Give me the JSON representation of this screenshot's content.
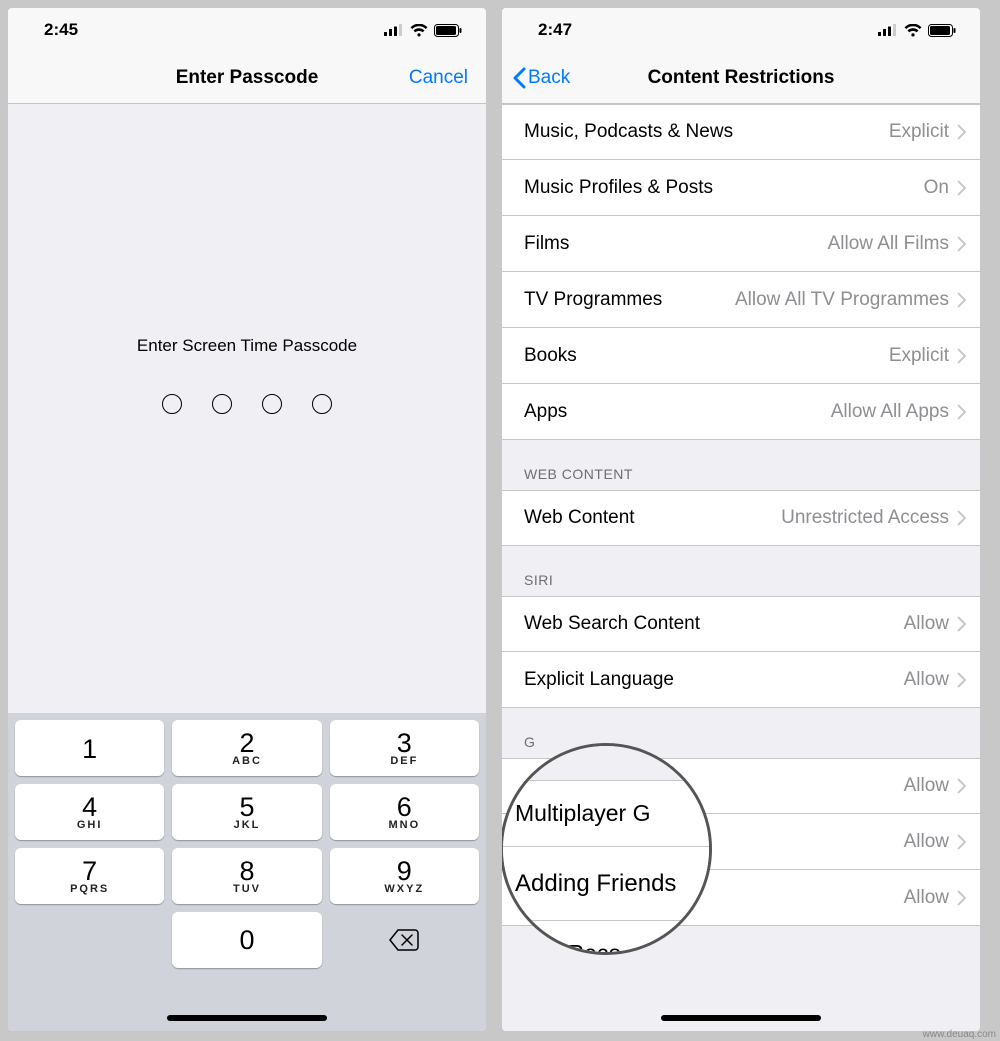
{
  "left": {
    "status": {
      "time": "2:45"
    },
    "nav": {
      "title": "Enter Passcode",
      "cancel": "Cancel"
    },
    "prompt": "Enter Screen Time Passcode",
    "keypad": [
      {
        "digit": "1",
        "letters": ""
      },
      {
        "digit": "2",
        "letters": "ABC"
      },
      {
        "digit": "3",
        "letters": "DEF"
      },
      {
        "digit": "4",
        "letters": "GHI"
      },
      {
        "digit": "5",
        "letters": "JKL"
      },
      {
        "digit": "6",
        "letters": "MNO"
      },
      {
        "digit": "7",
        "letters": "PQRS"
      },
      {
        "digit": "8",
        "letters": "TUV"
      },
      {
        "digit": "9",
        "letters": "WXYZ"
      }
    ],
    "zero": {
      "digit": "0",
      "letters": ""
    }
  },
  "right": {
    "status": {
      "time": "2:47"
    },
    "nav": {
      "back": "Back",
      "title": "Content Restrictions"
    },
    "rowsTop": [
      {
        "label": "Music, Podcasts & News",
        "value": "Explicit"
      },
      {
        "label": "Music Profiles & Posts",
        "value": "On"
      },
      {
        "label": "Films",
        "value": "Allow All Films"
      },
      {
        "label": "TV Programmes",
        "value": "Allow All TV Programmes"
      },
      {
        "label": "Books",
        "value": "Explicit"
      },
      {
        "label": "Apps",
        "value": "Allow All Apps"
      }
    ],
    "sectionWeb": "WEB CONTENT",
    "rowsWeb": [
      {
        "label": "Web Content",
        "value": "Unrestricted Access"
      }
    ],
    "sectionSiri": "SIRI",
    "rowsSiri": [
      {
        "label": "Web Search Content",
        "value": "Allow"
      },
      {
        "label": "Explicit Language",
        "value": "Allow"
      }
    ],
    "sectionGame": "G",
    "rowsGame": [
      {
        "label": "Multiplayer G",
        "value": "Allow"
      },
      {
        "label": "Adding Friends",
        "value": "Allow"
      },
      {
        "label": "reen Reco",
        "value": "Allow"
      }
    ],
    "magnifier": {
      "top": "Multiplayer G",
      "center": "Adding Friends",
      "bottom": "reen Reco"
    }
  },
  "watermark": "www.deuaq.com"
}
